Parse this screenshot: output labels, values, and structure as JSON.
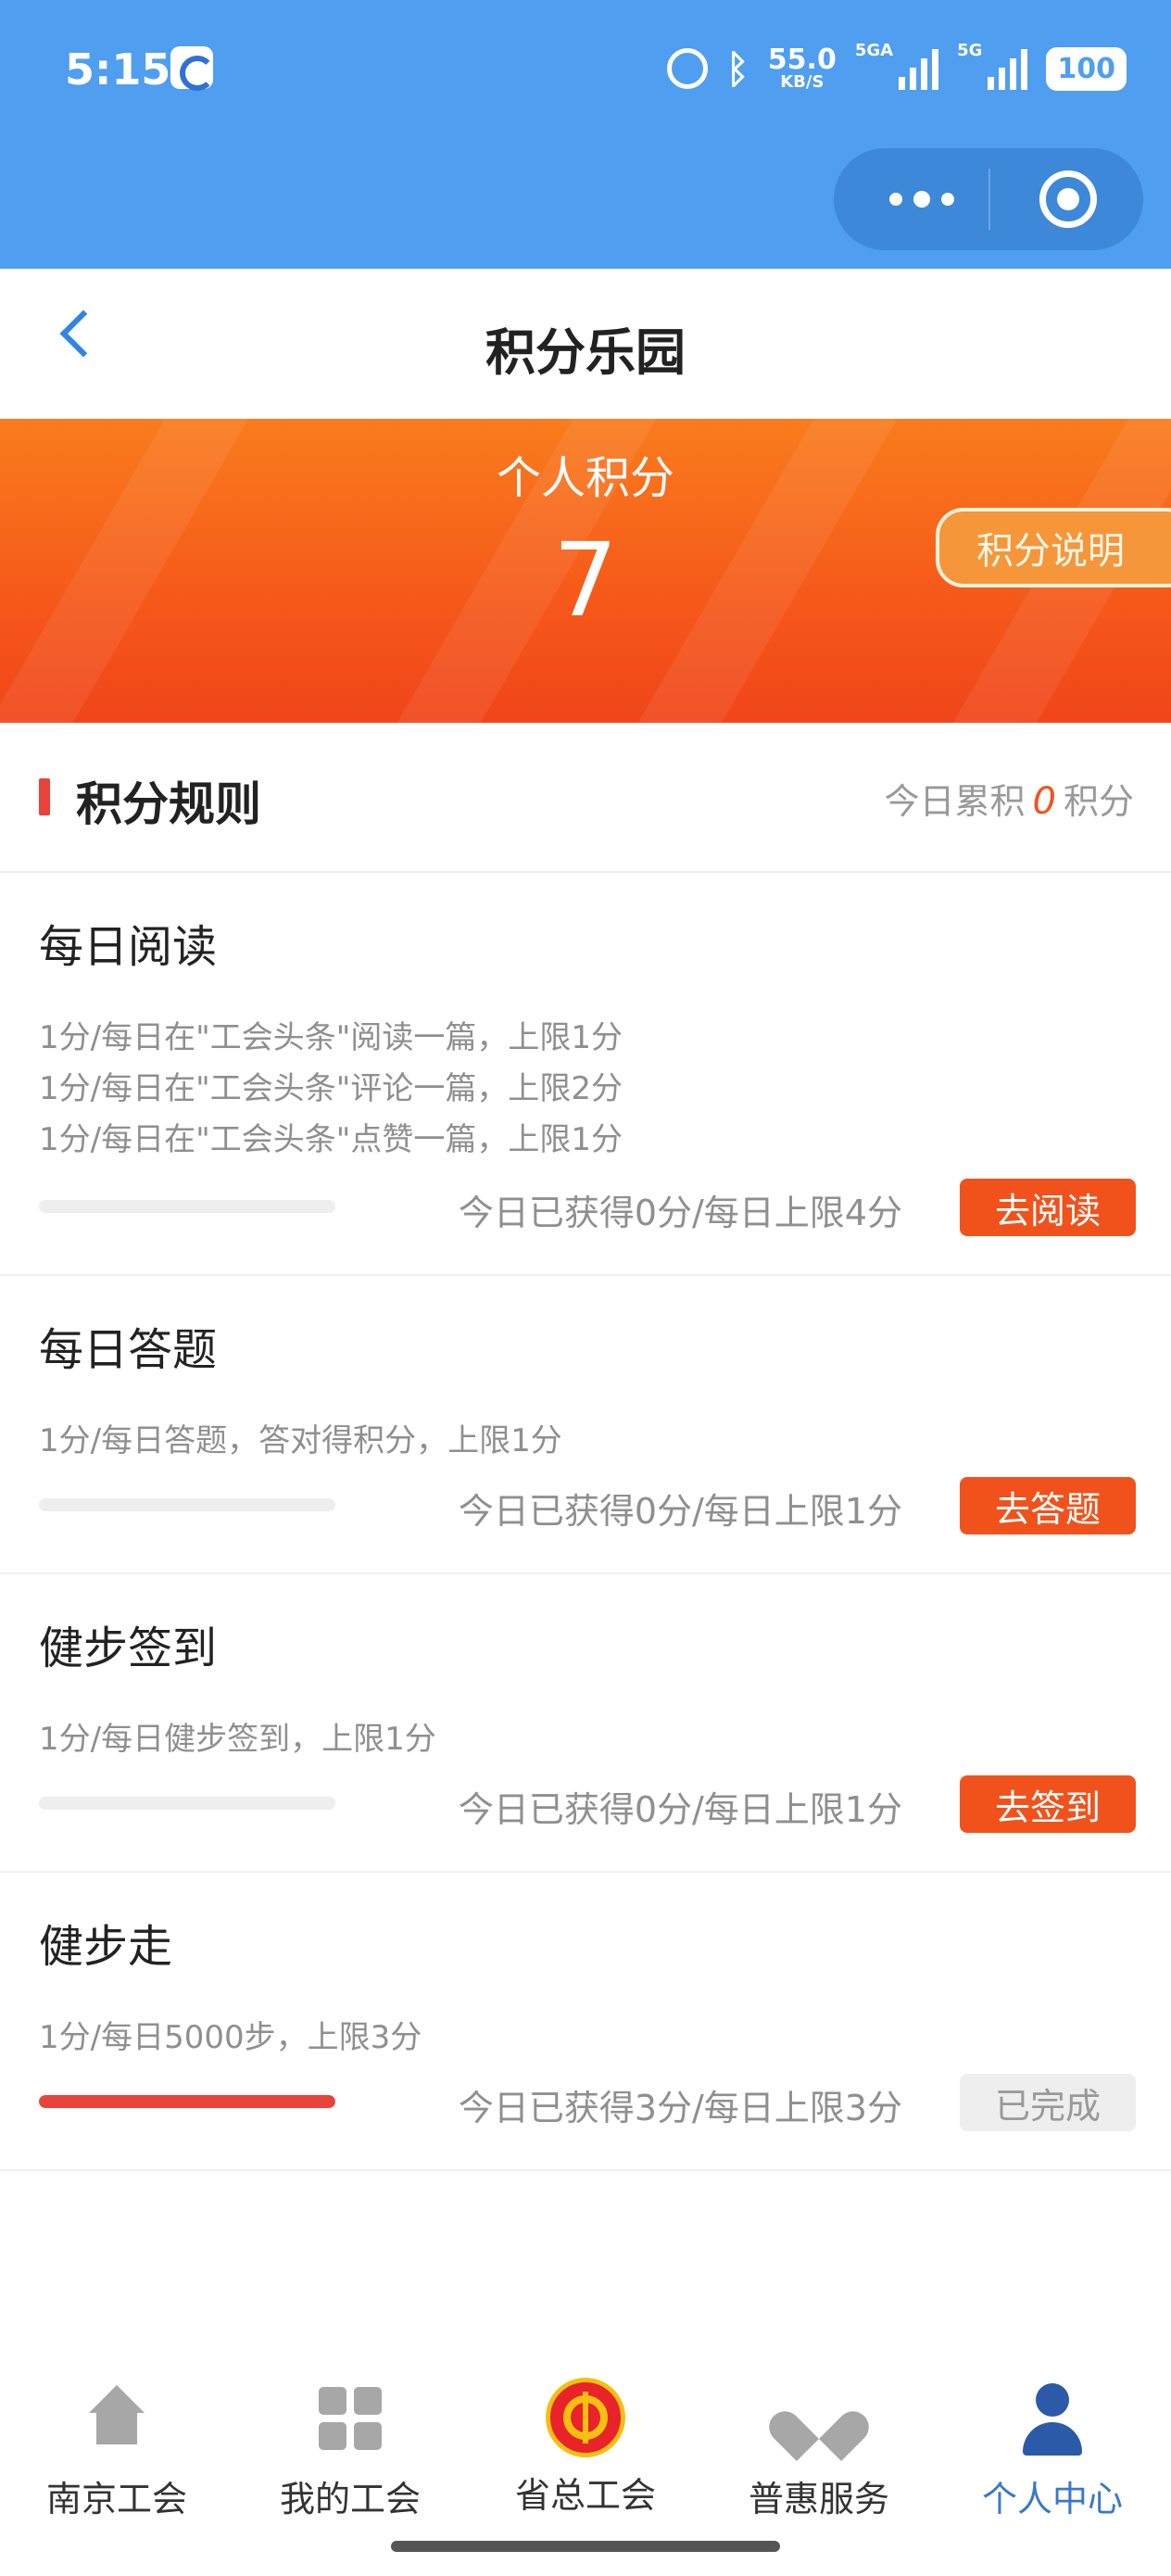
{
  "status_bar": {
    "time": "5:15",
    "net_speed": "55.0",
    "net_unit": "KB/S",
    "sig1_label": "5GA",
    "sig2_label": "5G",
    "battery": "100",
    "icons": [
      "app-icon",
      "alarm-icon",
      "bluetooth-icon",
      "signal-icon",
      "battery-icon"
    ]
  },
  "capsule": {
    "icons": [
      "more-icon",
      "target-icon"
    ]
  },
  "nav": {
    "title": "积分乐园",
    "back_icon": "chevron-left-icon"
  },
  "banner": {
    "label": "个人积分",
    "value": "7",
    "explain_button": "积分说明",
    "colors": {
      "start": "#f97c1d",
      "end": "#f0451a"
    }
  },
  "rules": {
    "title": "积分规则",
    "today_prefix": "今日累积",
    "today_value": "0",
    "today_suffix": "积分",
    "items": [
      {
        "title": "每日阅读",
        "lines": [
          "1分/每日在\"工会头条\"阅读一篇，上限1分",
          "1分/每日在\"工会头条\"评论一篇，上限2分",
          "1分/每日在\"工会头条\"点赞一篇，上限1分"
        ],
        "progress_text": "今日已获得0分/每日上限4分",
        "progress": 0,
        "action": "去阅读",
        "done": false
      },
      {
        "title": "每日答题",
        "lines": [
          "1分/每日答题，答对得积分，上限1分"
        ],
        "progress_text": "今日已获得0分/每日上限1分",
        "progress": 0,
        "action": "去答题",
        "done": false
      },
      {
        "title": "健步签到",
        "lines": [
          "1分/每日健步签到，上限1分"
        ],
        "progress_text": "今日已获得0分/每日上限1分",
        "progress": 0,
        "action": "去签到",
        "done": false
      },
      {
        "title": "健步走",
        "lines": [
          "1分/每日5000步，上限3分"
        ],
        "progress_text": "今日已获得3分/每日上限3分",
        "progress": 1,
        "action": "已完成",
        "done": true
      }
    ]
  },
  "tabbar": {
    "tabs": [
      {
        "label": "南京工会",
        "icon": "home-icon",
        "active": false
      },
      {
        "label": "我的工会",
        "icon": "grid-icon",
        "active": false
      },
      {
        "label": "省总工会",
        "icon": "union-logo-icon",
        "active": false
      },
      {
        "label": "普惠服务",
        "icon": "heart-icon",
        "active": false
      },
      {
        "label": "个人中心",
        "icon": "person-icon",
        "active": true
      }
    ]
  },
  "colors": {
    "header_blue": "#4f9ef0",
    "accent_orange": "#f1521b",
    "accent_red": "#e8433a",
    "active_tab": "#3a78c8"
  }
}
